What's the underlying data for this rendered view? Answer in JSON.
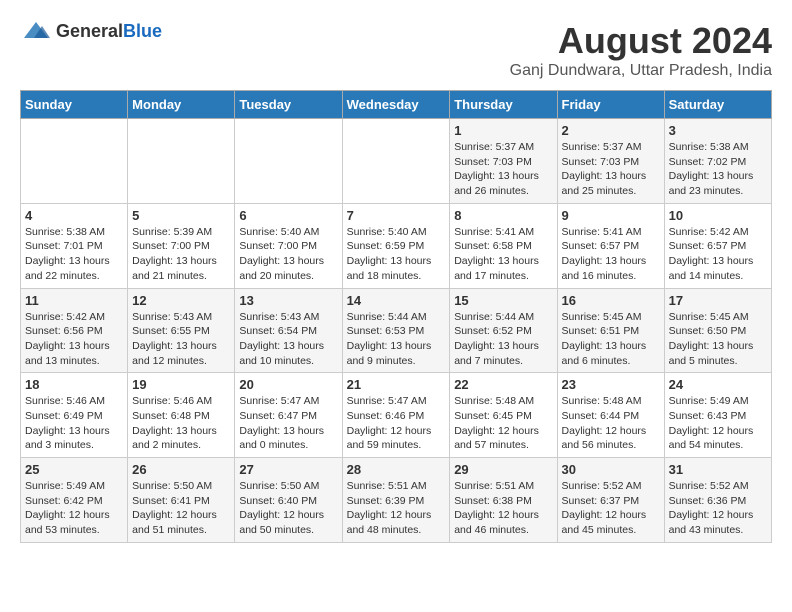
{
  "header": {
    "logo_general": "General",
    "logo_blue": "Blue",
    "month_title": "August 2024",
    "location": "Ganj Dundwara, Uttar Pradesh, India"
  },
  "days_of_week": [
    "Sunday",
    "Monday",
    "Tuesday",
    "Wednesday",
    "Thursday",
    "Friday",
    "Saturday"
  ],
  "weeks": [
    [
      {
        "day": "",
        "info": ""
      },
      {
        "day": "",
        "info": ""
      },
      {
        "day": "",
        "info": ""
      },
      {
        "day": "",
        "info": ""
      },
      {
        "day": "1",
        "info": "Sunrise: 5:37 AM\nSunset: 7:03 PM\nDaylight: 13 hours and 26 minutes."
      },
      {
        "day": "2",
        "info": "Sunrise: 5:37 AM\nSunset: 7:03 PM\nDaylight: 13 hours and 25 minutes."
      },
      {
        "day": "3",
        "info": "Sunrise: 5:38 AM\nSunset: 7:02 PM\nDaylight: 13 hours and 23 minutes."
      }
    ],
    [
      {
        "day": "4",
        "info": "Sunrise: 5:38 AM\nSunset: 7:01 PM\nDaylight: 13 hours and 22 minutes."
      },
      {
        "day": "5",
        "info": "Sunrise: 5:39 AM\nSunset: 7:00 PM\nDaylight: 13 hours and 21 minutes."
      },
      {
        "day": "6",
        "info": "Sunrise: 5:40 AM\nSunset: 7:00 PM\nDaylight: 13 hours and 20 minutes."
      },
      {
        "day": "7",
        "info": "Sunrise: 5:40 AM\nSunset: 6:59 PM\nDaylight: 13 hours and 18 minutes."
      },
      {
        "day": "8",
        "info": "Sunrise: 5:41 AM\nSunset: 6:58 PM\nDaylight: 13 hours and 17 minutes."
      },
      {
        "day": "9",
        "info": "Sunrise: 5:41 AM\nSunset: 6:57 PM\nDaylight: 13 hours and 16 minutes."
      },
      {
        "day": "10",
        "info": "Sunrise: 5:42 AM\nSunset: 6:57 PM\nDaylight: 13 hours and 14 minutes."
      }
    ],
    [
      {
        "day": "11",
        "info": "Sunrise: 5:42 AM\nSunset: 6:56 PM\nDaylight: 13 hours and 13 minutes."
      },
      {
        "day": "12",
        "info": "Sunrise: 5:43 AM\nSunset: 6:55 PM\nDaylight: 13 hours and 12 minutes."
      },
      {
        "day": "13",
        "info": "Sunrise: 5:43 AM\nSunset: 6:54 PM\nDaylight: 13 hours and 10 minutes."
      },
      {
        "day": "14",
        "info": "Sunrise: 5:44 AM\nSunset: 6:53 PM\nDaylight: 13 hours and 9 minutes."
      },
      {
        "day": "15",
        "info": "Sunrise: 5:44 AM\nSunset: 6:52 PM\nDaylight: 13 hours and 7 minutes."
      },
      {
        "day": "16",
        "info": "Sunrise: 5:45 AM\nSunset: 6:51 PM\nDaylight: 13 hours and 6 minutes."
      },
      {
        "day": "17",
        "info": "Sunrise: 5:45 AM\nSunset: 6:50 PM\nDaylight: 13 hours and 5 minutes."
      }
    ],
    [
      {
        "day": "18",
        "info": "Sunrise: 5:46 AM\nSunset: 6:49 PM\nDaylight: 13 hours and 3 minutes."
      },
      {
        "day": "19",
        "info": "Sunrise: 5:46 AM\nSunset: 6:48 PM\nDaylight: 13 hours and 2 minutes."
      },
      {
        "day": "20",
        "info": "Sunrise: 5:47 AM\nSunset: 6:47 PM\nDaylight: 13 hours and 0 minutes."
      },
      {
        "day": "21",
        "info": "Sunrise: 5:47 AM\nSunset: 6:46 PM\nDaylight: 12 hours and 59 minutes."
      },
      {
        "day": "22",
        "info": "Sunrise: 5:48 AM\nSunset: 6:45 PM\nDaylight: 12 hours and 57 minutes."
      },
      {
        "day": "23",
        "info": "Sunrise: 5:48 AM\nSunset: 6:44 PM\nDaylight: 12 hours and 56 minutes."
      },
      {
        "day": "24",
        "info": "Sunrise: 5:49 AM\nSunset: 6:43 PM\nDaylight: 12 hours and 54 minutes."
      }
    ],
    [
      {
        "day": "25",
        "info": "Sunrise: 5:49 AM\nSunset: 6:42 PM\nDaylight: 12 hours and 53 minutes."
      },
      {
        "day": "26",
        "info": "Sunrise: 5:50 AM\nSunset: 6:41 PM\nDaylight: 12 hours and 51 minutes."
      },
      {
        "day": "27",
        "info": "Sunrise: 5:50 AM\nSunset: 6:40 PM\nDaylight: 12 hours and 50 minutes."
      },
      {
        "day": "28",
        "info": "Sunrise: 5:51 AM\nSunset: 6:39 PM\nDaylight: 12 hours and 48 minutes."
      },
      {
        "day": "29",
        "info": "Sunrise: 5:51 AM\nSunset: 6:38 PM\nDaylight: 12 hours and 46 minutes."
      },
      {
        "day": "30",
        "info": "Sunrise: 5:52 AM\nSunset: 6:37 PM\nDaylight: 12 hours and 45 minutes."
      },
      {
        "day": "31",
        "info": "Sunrise: 5:52 AM\nSunset: 6:36 PM\nDaylight: 12 hours and 43 minutes."
      }
    ]
  ]
}
